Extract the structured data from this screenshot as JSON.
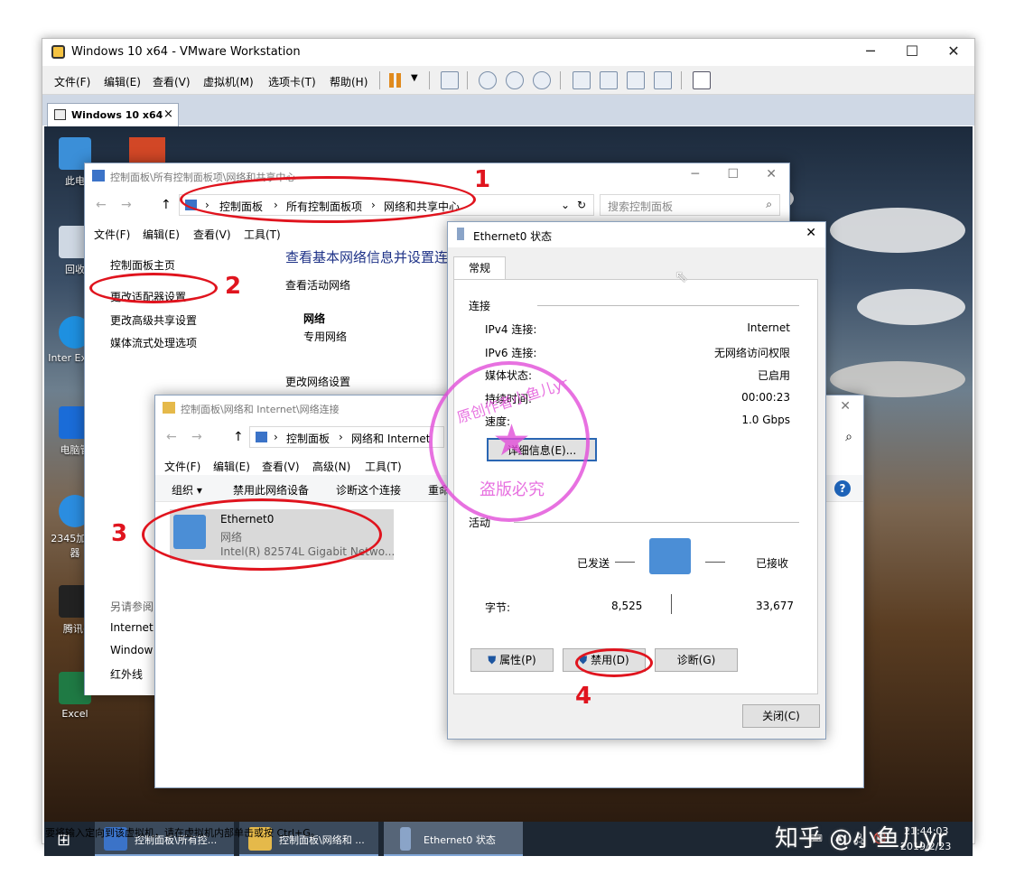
{
  "vmware": {
    "title": "Windows 10 x64 - VMware Workstation",
    "menu": [
      "文件(F)",
      "编辑(E)",
      "查看(V)",
      "虚拟机(M)",
      "选项卡(T)",
      "帮助(H)"
    ],
    "tab_label": "Windows 10 x64",
    "status_hint": "要将输入定向到该虚拟机，请在虚拟机内部单击或按 Ctrl+G。"
  },
  "desktop_icons": [
    "此电",
    "回收",
    "Inter Explo",
    "电脑管",
    "2345加 览器",
    "腾讯(",
    "Excel"
  ],
  "control_panel": {
    "title": "控制面板\\所有控制面板项\\网络和共享中心",
    "crumbs": [
      "控制面板",
      "所有控制面板项",
      "网络和共享中心"
    ],
    "search_placeholder": "搜索控制面板",
    "menu": [
      "文件(F)",
      "编辑(E)",
      "查看(V)",
      "工具(T)"
    ],
    "sidebar": [
      "控制面板主页",
      "更改适配器设置",
      "更改高级共享设置",
      "媒体流式处理选项"
    ],
    "see_also": [
      "另请参阅",
      "Internet",
      "Window",
      "红外线"
    ],
    "heading": "查看基本网络信息并设置连",
    "active_networks": "查看活动网络",
    "network_name": "网络",
    "network_type": "专用网络",
    "change_settings": "更改网络设置"
  },
  "net_connections": {
    "title": "控制面板\\网络和 Internet\\网络连接",
    "crumbs": [
      "控制面板",
      "网络和 Internet"
    ],
    "menu": [
      "文件(F)",
      "编辑(E)",
      "查看(V)",
      "高级(N)",
      "工具(T)"
    ],
    "commands": [
      "组织 ▾",
      "禁用此网络设备",
      "诊断这个连接",
      "重命"
    ],
    "adapter": {
      "name": "Ethernet0",
      "network": "网络",
      "device": "Intel(R) 82574L Gigabit Netwo..."
    }
  },
  "status_dialog": {
    "title": "Ethernet0 状态",
    "tab": "常规",
    "connection_section": "连接",
    "rows": [
      {
        "label": "IPv4 连接:",
        "value": "Internet"
      },
      {
        "label": "IPv6 连接:",
        "value": "无网络访问权限"
      },
      {
        "label": "媒体状态:",
        "value": "已启用"
      },
      {
        "label": "持续时间:",
        "value": "00:00:23"
      },
      {
        "label": "速度:",
        "value": "1.0 Gbps"
      }
    ],
    "details_button": "详细信息(E)...",
    "activity_section": "活动",
    "sent_label": "已发送",
    "received_label": "已接收",
    "bytes_label": "字节:",
    "bytes_sent": "8,525",
    "bytes_received": "33,677",
    "buttons": [
      "属性(P)",
      "禁用(D)",
      "诊断(G)"
    ],
    "close_button": "关闭(C)"
  },
  "taskbar": {
    "items": [
      "控制面板\\所有控...",
      "控制面板\\网络和 ...",
      "Ethernet0 状态"
    ],
    "time": "21:44:03",
    "date": "2019/2/23"
  },
  "annotations": [
    "1",
    "2",
    "3",
    "4"
  ],
  "stamp_text": [
    "原创作者小鱼儿yr",
    "盗版必究"
  ],
  "watermark": "知乎 @小鱼儿yr",
  "colors": {
    "annotation_red": "#e0141e",
    "stamp_pink": "#e24ed9",
    "link_blue": "#1e56a0"
  }
}
